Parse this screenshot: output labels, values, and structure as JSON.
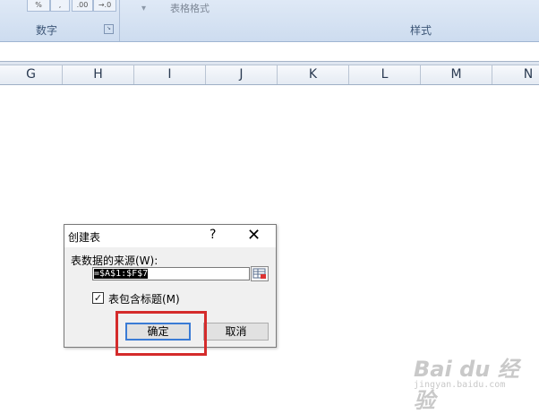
{
  "ribbon": {
    "table_format_label": "表格格式",
    "format_dropdown_glyph": "▾",
    "number_group_label": "数字",
    "styles_group_label": "样式",
    "percent_label": "%",
    "comma_label": ",",
    "increase_decimal_label": ".00",
    "decrease_decimal_label": "→.0"
  },
  "columns": [
    "G",
    "H",
    "I",
    "J",
    "K",
    "L",
    "M",
    "N"
  ],
  "dialog": {
    "title": "创建表",
    "help": "?",
    "close": "✕",
    "source_label": "表数据的来源(W):",
    "range_value": "=$A$1:$F$7",
    "has_headers_label": "表包含标题(M)",
    "has_headers_checked": true,
    "ok_label": "确定",
    "cancel_label": "取消"
  },
  "watermark": {
    "logo_text": "Bai du 经验",
    "url": "jingyan.baidu.com"
  }
}
